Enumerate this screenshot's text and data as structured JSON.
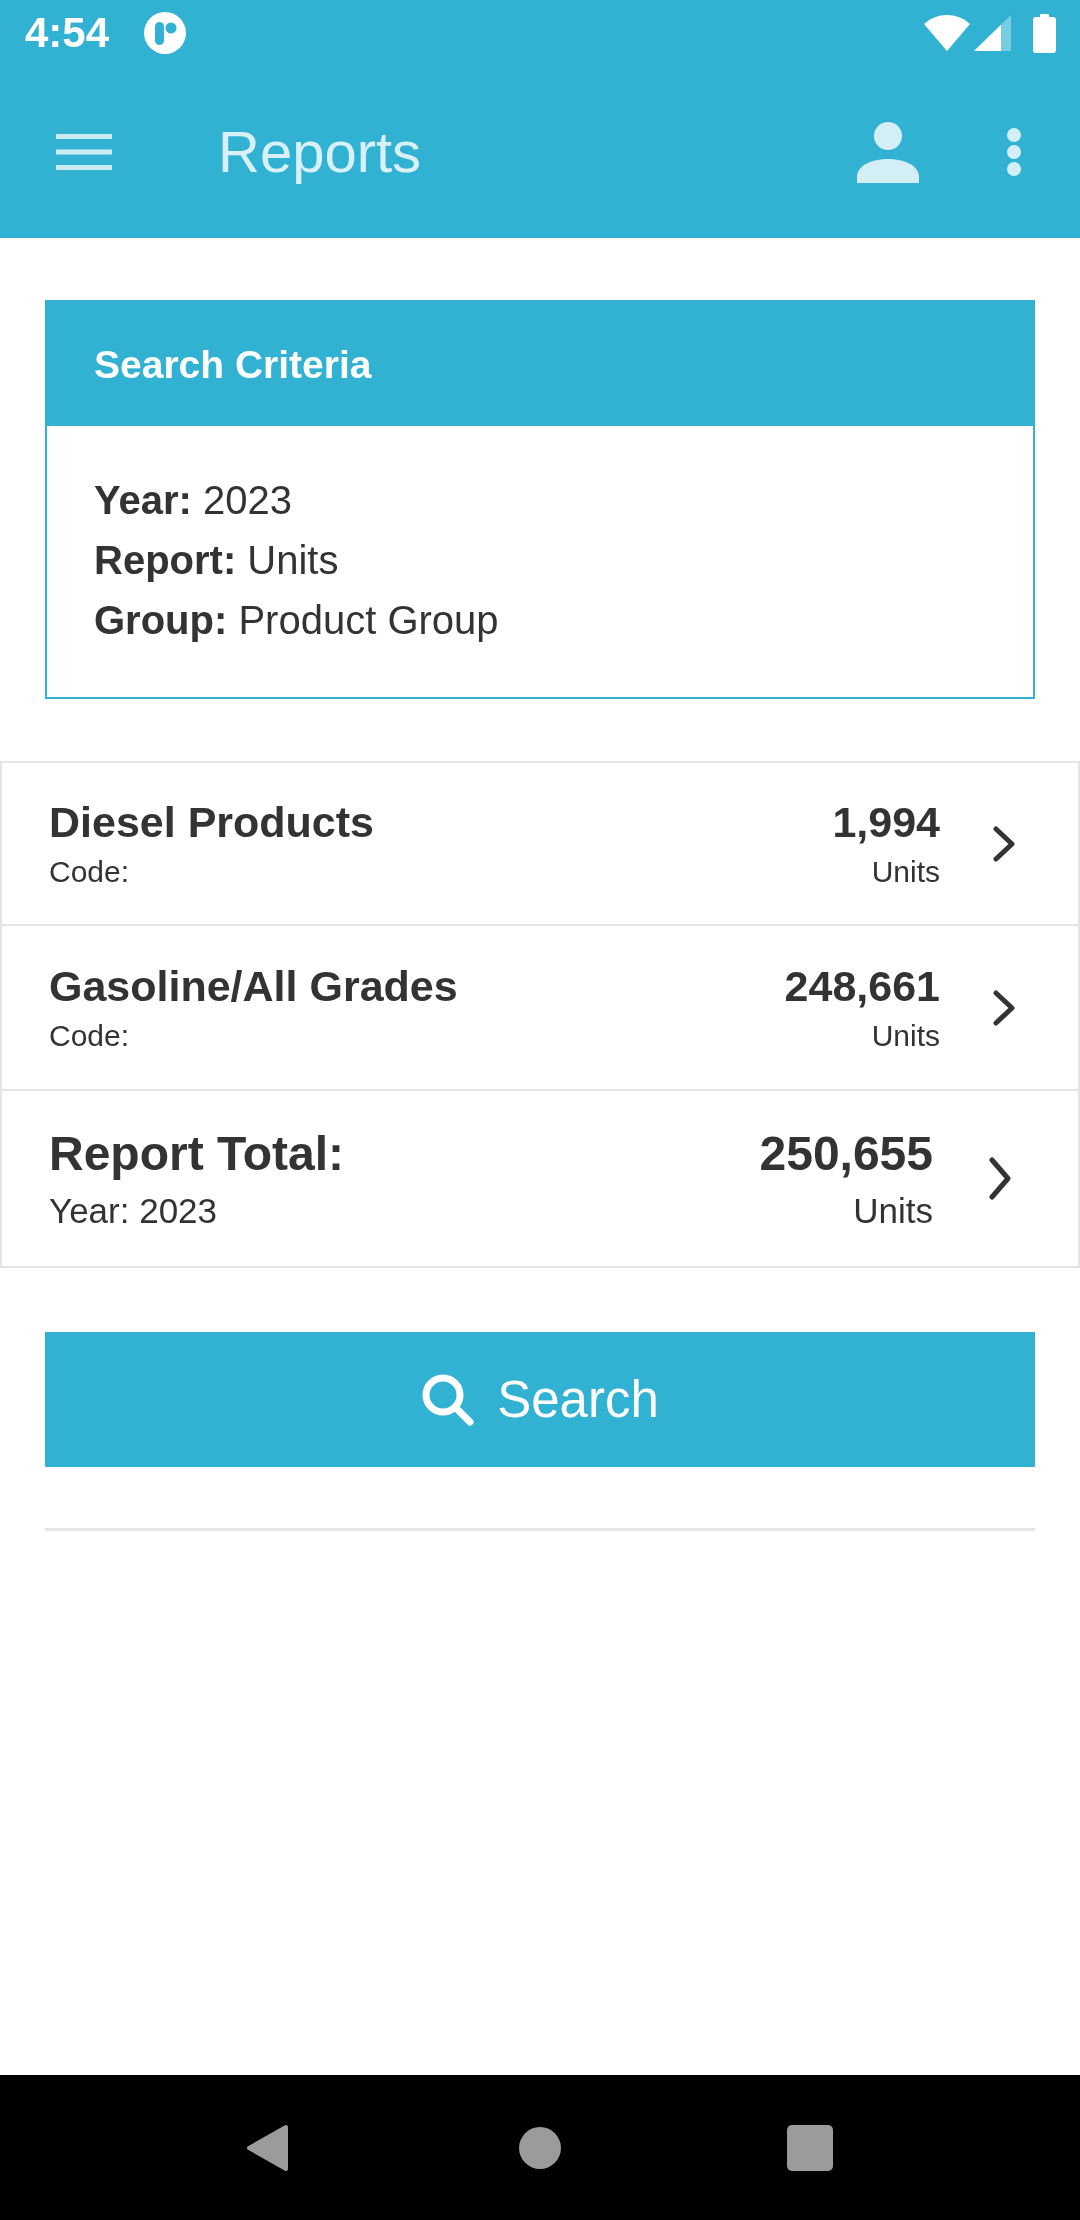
{
  "status_bar": {
    "time": "4:54"
  },
  "app_bar": {
    "title": "Reports"
  },
  "search_criteria": {
    "title": "Search Criteria",
    "fields": [
      {
        "label": "Year:",
        "value": "2023"
      },
      {
        "label": "Report:",
        "value": "Units"
      },
      {
        "label": "Group:",
        "value": "Product Group"
      }
    ]
  },
  "results": [
    {
      "kind": "group",
      "title": "Diesel Products",
      "subtitle": "Code:",
      "value": "1,994",
      "unit": "Units"
    },
    {
      "kind": "group",
      "title": "Gasoline/All Grades",
      "subtitle": "Code:",
      "value": "248,661",
      "unit": "Units"
    },
    {
      "kind": "total",
      "title": "Report Total:",
      "subtitle": "Year: 2023",
      "value": "250,655",
      "unit": "Units"
    }
  ],
  "search_button": {
    "label": "Search"
  }
}
